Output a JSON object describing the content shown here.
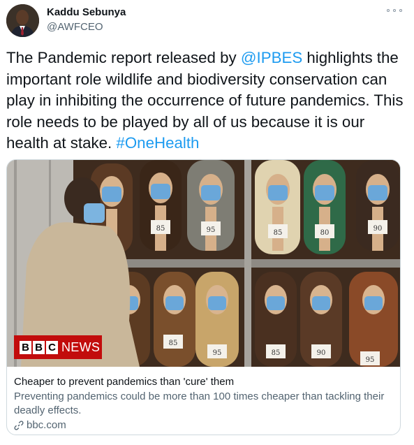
{
  "author": {
    "name": "Kaddu Sebunya",
    "handle": "@AWFCEO"
  },
  "tweet": {
    "text_1": "The Pandemic report released by ",
    "mention": "@IPBES",
    "text_2": " highlights the important role wildlife and biodiversity conservation can play in inhibiting the occurrence of future pandemics. This role needs to be played by all of us because it is our health at stake. ",
    "hashtag": "#OneHealth"
  },
  "card": {
    "image_logo_box_1": "B",
    "image_logo_box_2": "B",
    "image_logo_box_3": "C",
    "image_logo_text": "NEWS",
    "title": "Cheaper to prevent pandemics than 'cure' them",
    "description": "Preventing pandemics could be more than 100 times cheaper than tackling their deadly effects.",
    "domain": "bbc.com",
    "price_tags": [
      "85",
      "95",
      "85",
      "80",
      "90",
      "85",
      "95",
      "85",
      "90",
      "95"
    ]
  },
  "icons": {
    "more": "more-icon",
    "link": "link-icon"
  },
  "colors": {
    "link": "#1d9bf0",
    "secondary_text": "#536471",
    "bbc_red": "#c20c0c"
  }
}
